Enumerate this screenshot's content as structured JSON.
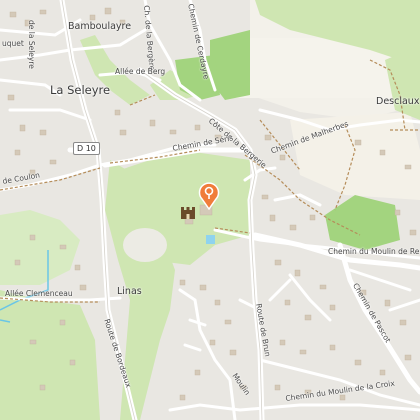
{
  "map": {
    "places": {
      "seleyre": "La Seleyre",
      "bamboulayre": "Bamboulayre",
      "desclaux": "Desclaux",
      "linas": "Linas",
      "quet": "uquet"
    },
    "roads": {
      "seleyre_ch": "de la Seleyre",
      "bergerie_ch": "Ch. de la Bergère",
      "cerdayre": "Chemin de Cerdayre",
      "berg_allee": "Allée de Berg",
      "bergerie_cote": "Côte de la Bergerie",
      "malherbes": "Chemin de Malherbes",
      "d10": "D 10",
      "seris": "Chemin de Séris",
      "coulon": "de Coulon",
      "moulin_re": "Chemin du Moulin de Re",
      "pascot": "Chemin de Pascot",
      "clemenceau": "Allée Clemenceau",
      "bordeaux": "Route de Bordeaux",
      "brun": "Route de Brun",
      "moulin_bas": "Moulin",
      "croix": "Chemin du Moulin de la Croix"
    },
    "marker_icon": "map-pin-icon",
    "poi_icon": "castle-icon",
    "colors": {
      "park": "#cfe6b2",
      "forest": "#a3d47f",
      "land": "#e9e7e2",
      "road": "#ffffff",
      "marker": "#f07c3a"
    }
  }
}
